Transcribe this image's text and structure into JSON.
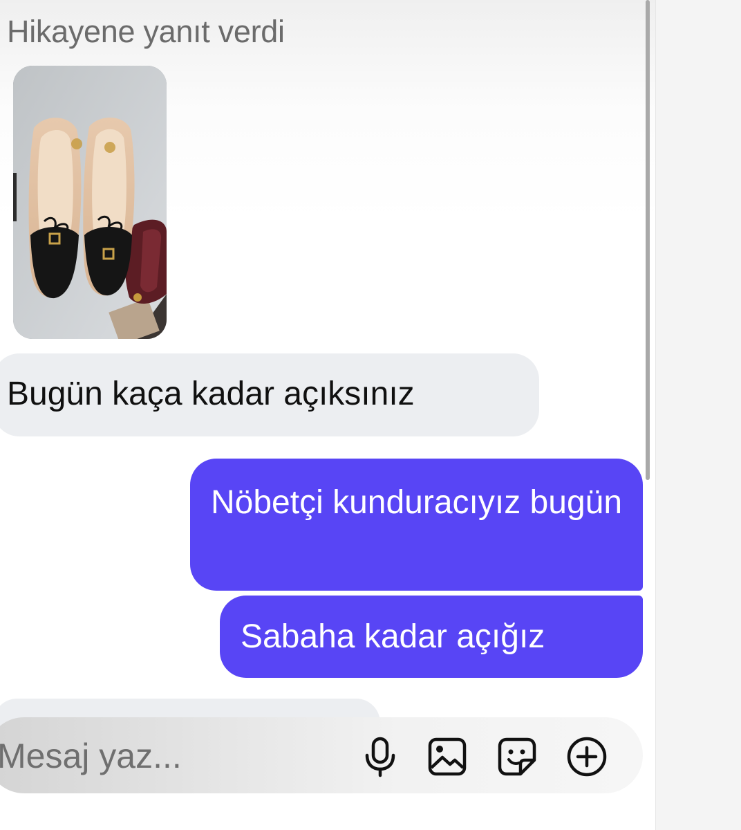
{
  "thread": {
    "story_reply_label": "Hikayene yanıt verdi",
    "messages": [
      {
        "sender": "them",
        "text": "Bugün kaça kadar açıksınız"
      },
      {
        "sender": "me",
        "text": "Nöbetçi kunduracıyız bugün"
      },
      {
        "sender": "me",
        "text": "Sabaha kadar açığız"
      }
    ]
  },
  "composer": {
    "placeholder": "Mesaj yaz...",
    "icons": [
      "microphone-icon",
      "image-icon",
      "sticker-icon",
      "plus-circle-icon"
    ]
  },
  "colors": {
    "outgoing_bubble": "#5845f5",
    "incoming_bubble": "#eceef1"
  }
}
